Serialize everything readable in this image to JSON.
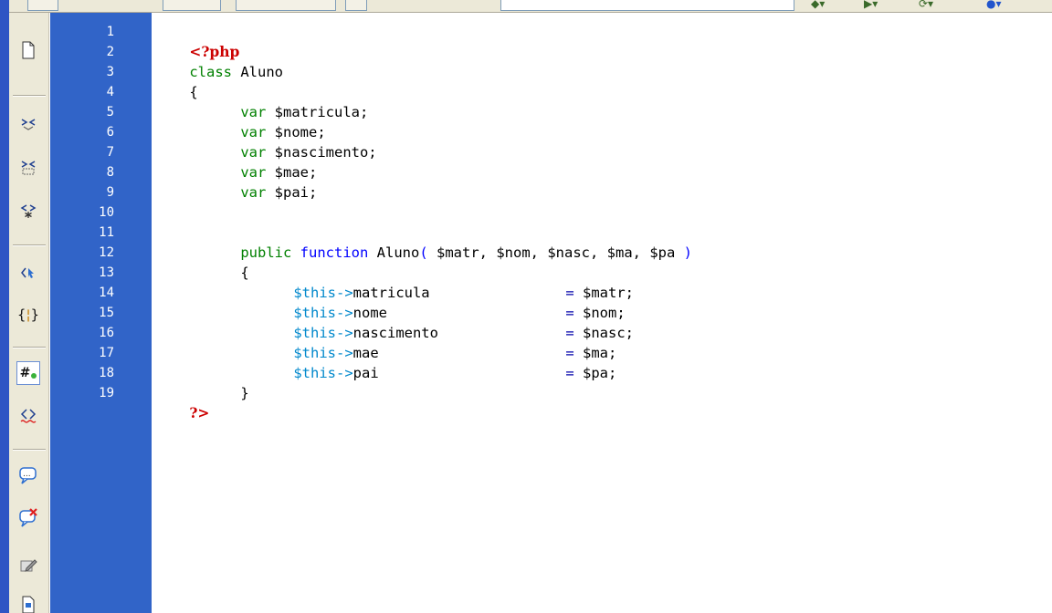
{
  "tool_icons": [
    {
      "name": "new-document-icon",
      "glyph": "🗋"
    },
    {
      "name": "collapse-tag-icon",
      "glyph": "⇆"
    },
    {
      "name": "collapse-selection-icon",
      "glyph": "⬚"
    },
    {
      "name": "expand-all-icon",
      "glyph": "✱"
    },
    {
      "name": "select-parent-tag-icon",
      "glyph": "⟨"
    },
    {
      "name": "balance-braces-icon",
      "glyph": "{}"
    },
    {
      "name": "line-numbers-icon",
      "glyph": "#"
    },
    {
      "name": "highlight-invalid-code-icon",
      "glyph": "<>"
    },
    {
      "name": "apply-comment-icon",
      "glyph": "💬"
    },
    {
      "name": "remove-comment-icon",
      "glyph": "✖"
    },
    {
      "name": "wrap-tag-icon",
      "glyph": "✎"
    },
    {
      "name": "recent-snippets-icon",
      "glyph": "🗎"
    }
  ],
  "line_numbers": [
    "1",
    "2",
    "3",
    "4",
    "5",
    "6",
    "7",
    "8",
    "9",
    "10",
    "11",
    "12",
    "13",
    "14",
    "15",
    "16",
    "17",
    "18",
    "19"
  ],
  "code": {
    "l1": "<?php",
    "l2_kw": "class",
    "l2_rest": " Aluno",
    "l3": "{",
    "l4_kw": "var",
    "l4_rest": " $matricula;",
    "l5_kw": "var",
    "l5_rest": " $nome;",
    "l6_kw": "var",
    "l6_rest": " $nascimento;",
    "l7_kw": "var",
    "l7_rest": " $mae;",
    "l8_kw": "var",
    "l8_rest": " $pai;",
    "l10_kw": "public",
    "l10_fn": "function",
    "l10_name": "Aluno",
    "l10_paren_open": "(",
    "l10_params": " $matr, $nom, $nasc, $ma, $pa ",
    "l10_paren_close": ")",
    "l11": "{",
    "l12_this": "$this->",
    "l12_prop": "matricula",
    "l12_op": "=",
    "l12_val": "$matr;",
    "l13_this": "$this->",
    "l13_prop": "nome",
    "l13_op": "=",
    "l13_val": "$nom;",
    "l14_this": "$this->",
    "l14_prop": "nascimento",
    "l14_op": "=",
    "l14_val": "$nasc;",
    "l15_this": "$this->",
    "l15_prop": "mae",
    "l15_op": "=",
    "l15_val": "$ma;",
    "l16_this": "$this->",
    "l16_prop": "pai",
    "l16_op": "=",
    "l16_val": "$pa;",
    "l17": "}",
    "l18": "?>"
  },
  "colors": {
    "gutter": "#3164c8",
    "keyword": "#008000",
    "function_keyword": "#0000ff",
    "php_tag": "#cc0000",
    "this_ref": "#0088cc"
  }
}
